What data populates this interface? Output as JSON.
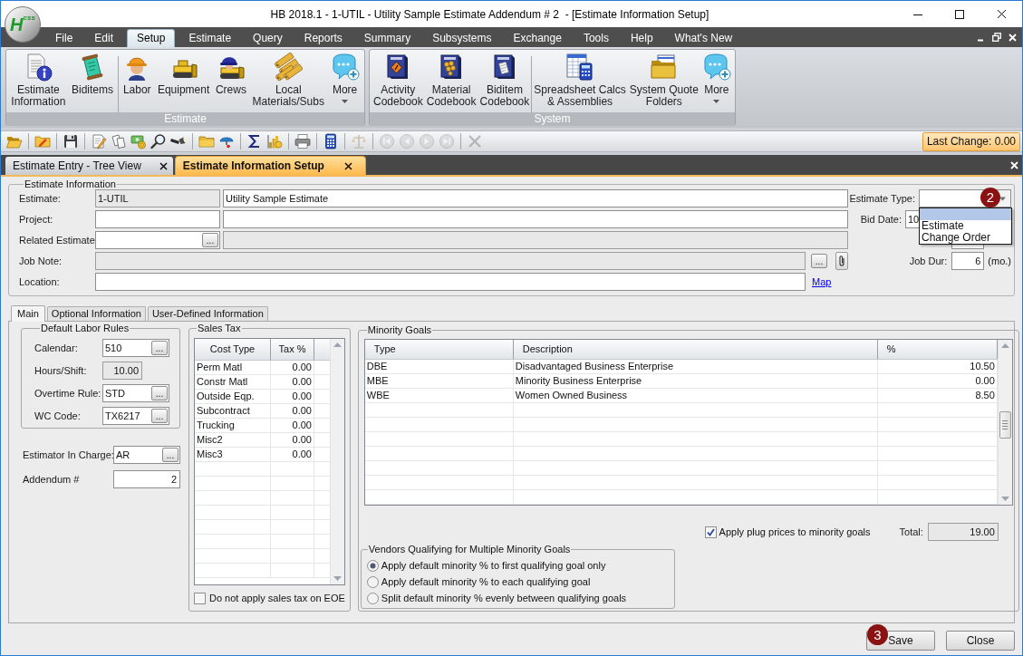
{
  "window": {
    "logo": "H$^{css}$",
    "title": "HB 2018.1 - 1-UTIL - Utility Sample Estimate Addendum # 2  - [Estimate Information Setup]"
  },
  "menu": [
    {
      "label": "File",
      "selected": false
    },
    {
      "label": "Edit",
      "selected": false
    },
    {
      "label": "Setup",
      "selected": true
    },
    {
      "label": "Estimate",
      "selected": false
    },
    {
      "label": "Query",
      "selected": false
    },
    {
      "label": "Reports",
      "selected": false
    },
    {
      "label": "Summary",
      "selected": false
    },
    {
      "label": "Subsystems",
      "selected": false
    },
    {
      "label": "Exchange",
      "selected": false
    },
    {
      "label": "Tools",
      "selected": false
    },
    {
      "label": "Help",
      "selected": false
    },
    {
      "label": "What's New",
      "selected": false
    }
  ],
  "ribbon": {
    "groups": [
      {
        "label": "Estimate",
        "sections": [
          [
            {
              "kind": "document-info",
              "lines": [
                "Estimate",
                "Information"
              ],
              "dropdown": false
            },
            {
              "kind": "scroll",
              "lines": [
                "Biditems"
              ],
              "dropdown": false
            }
          ],
          [
            {
              "kind": "worker",
              "lines": [
                "Labor"
              ],
              "dropdown": false
            },
            {
              "kind": "bulldozer",
              "lines": [
                "Equipment"
              ],
              "dropdown": false
            },
            {
              "kind": "crew",
              "lines": [
                "Crews"
              ],
              "dropdown": false
            },
            {
              "kind": "pipes",
              "lines": [
                "Local",
                "Materials/Subs"
              ],
              "dropdown": false
            },
            {
              "kind": "more",
              "lines": [
                "More"
              ],
              "dropdown": true
            }
          ]
        ]
      },
      {
        "label": "System",
        "sections": [
          [
            {
              "kind": "book-sign",
              "lines": [
                "Activity",
                "Codebook"
              ],
              "dropdown": false
            },
            {
              "kind": "book-pipes",
              "lines": [
                "Material",
                "Codebook"
              ],
              "dropdown": false
            },
            {
              "kind": "book-scroll",
              "lines": [
                "Biditem",
                "Codebook"
              ],
              "dropdown": false
            }
          ],
          [
            {
              "kind": "spreadsheet",
              "lines": [
                "Spreadsheet Calcs",
                "& Assemblies"
              ],
              "dropdown": false
            },
            {
              "kind": "folders",
              "lines": [
                "System Quote",
                "Folders"
              ],
              "dropdown": false
            },
            {
              "kind": "more",
              "lines": [
                "More"
              ],
              "dropdown": true
            }
          ]
        ]
      }
    ]
  },
  "toolbar": {
    "sections": [
      [
        {
          "kind": "open",
          "disabled": false
        }
      ],
      [
        {
          "kind": "folder-pencil",
          "disabled": false
        }
      ],
      [
        {
          "kind": "save",
          "disabled": false
        }
      ],
      [
        {
          "kind": "notes",
          "disabled": false
        },
        {
          "kind": "copy",
          "disabled": false
        },
        {
          "kind": "money",
          "disabled": false
        },
        {
          "kind": "search",
          "disabled": false
        },
        {
          "kind": "flashlight",
          "disabled": false
        }
      ],
      [
        {
          "kind": "folder",
          "disabled": false
        },
        {
          "kind": "dish",
          "disabled": false
        }
      ],
      [
        {
          "kind": "sum",
          "disabled": false
        },
        {
          "kind": "chart",
          "disabled": false
        }
      ],
      [
        {
          "kind": "print",
          "disabled": false
        }
      ],
      [
        {
          "kind": "calculator",
          "disabled": false
        }
      ],
      [
        {
          "kind": "scale",
          "disabled": true
        }
      ],
      [
        {
          "kind": "first",
          "disabled": true
        },
        {
          "kind": "previous",
          "disabled": true
        },
        {
          "kind": "next",
          "disabled": true
        },
        {
          "kind": "last",
          "disabled": true
        }
      ],
      [
        {
          "kind": "delete",
          "disabled": true
        }
      ]
    ],
    "last_change": "Last Change: 0.00"
  },
  "document_tabs": [
    {
      "label": "Estimate Entry - Tree View",
      "selected": false
    },
    {
      "label": "Estimate Information Setup",
      "selected": true
    }
  ],
  "estimate_information": {
    "title": "Estimate Information",
    "rows": [
      {
        "label": "Estimate:",
        "fields": [
          {
            "kind": "short",
            "value": "1-UTIL",
            "disabled": true
          },
          {
            "kind": "wide",
            "value": "Utility Sample Estimate",
            "disabled": false
          }
        ]
      },
      {
        "label": "Project:",
        "fields": [
          {
            "kind": "short",
            "disabled": false
          },
          {
            "kind": "wide",
            "disabled": false
          }
        ]
      },
      {
        "label": "Related Estimate:",
        "fields": [
          {
            "kind": "short",
            "disabled": false,
            "lookup": "..."
          },
          {
            "kind": "wide",
            "disabled": true
          }
        ]
      },
      {
        "label": "Job Note:",
        "fields": [
          {
            "kind": "full",
            "disabled": true,
            "button": "...",
            "attachment": true
          }
        ]
      },
      {
        "label": "Location:",
        "fields": [
          {
            "kind": "full",
            "disabled": false,
            "link": "Map"
          }
        ]
      }
    ],
    "estimate_type": {
      "label": "Estimate Type:",
      "marker": "2",
      "expanded": true,
      "blank_option_selected": true,
      "options": [
        {
          "label": "Estimate",
          "selected": false
        },
        {
          "label": "Change Order",
          "selected": false
        }
      ]
    },
    "bid_date": {
      "label": "Bid Date:",
      "value": "10"
    },
    "job_duration": {
      "label": "Job Dur:",
      "value": "6",
      "unit": "(mo.)"
    }
  },
  "tabs": [
    {
      "label": "Main",
      "selected": true
    },
    {
      "label": "Optional Information",
      "selected": false
    },
    {
      "label": "User-Defined Information",
      "selected": false
    }
  ],
  "default_labor_rules": {
    "title": "Default Labor Rules",
    "fields": [
      {
        "label": "Calendar:",
        "value": "510",
        "lookup": "...",
        "disabled": false
      },
      {
        "label": "Hours/Shift:",
        "value": "10.00",
        "disabled": true
      },
      {
        "label": "Overtime Rule:",
        "value": "STD",
        "lookup": "...",
        "disabled": false
      },
      {
        "label": "WC Code:",
        "value": "TX6217",
        "lookup": "...",
        "disabled": false
      }
    ]
  },
  "estimator_in_charge": {
    "label": "Estimator In Charge:",
    "value": "AR",
    "lookup": "..."
  },
  "addendum": {
    "label": "Addendum #",
    "value": "2"
  },
  "sales_tax": {
    "title": "Sales Tax",
    "columns": [
      "Cost Type",
      "Tax %"
    ],
    "rows": [
      [
        "Perm Matl",
        "0.00"
      ],
      [
        "Constr Matl",
        "0.00"
      ],
      [
        "Outside Eqp.",
        "0.00"
      ],
      [
        "Subcontract",
        "0.00"
      ],
      [
        "Trucking",
        "0.00"
      ],
      [
        "Misc2",
        "0.00"
      ],
      [
        "Misc3",
        "0.00"
      ]
    ],
    "no_tax_on_eoe": {
      "label": "Do not apply sales tax on EOE",
      "checked": false
    }
  },
  "minority_goals": {
    "title": "Minority Goals",
    "columns": [
      "Type",
      "Description",
      "%"
    ],
    "rows": [
      [
        "DBE",
        "Disadvantaged Business Enterprise",
        "10.50"
      ],
      [
        "MBE",
        "Minority Business Enterprise",
        "0.00"
      ],
      [
        "WBE",
        "Women Owned Business",
        "8.50"
      ]
    ],
    "plug_prices": {
      "label": "Apply plug prices to minority goals",
      "checked": true
    },
    "total": {
      "label": "Total:",
      "value": "19.00"
    },
    "vendors": {
      "title": "Vendors Qualifying for Multiple Minority Goals",
      "options": [
        {
          "label": "Apply default minority % to first qualifying goal only",
          "selected": true
        },
        {
          "label": "Apply default minority % to each qualifying goal",
          "selected": false
        },
        {
          "label": "Split default minority % evenly between qualifying goals",
          "selected": false
        }
      ]
    }
  },
  "buttons": [
    {
      "label": "Save",
      "marker": "3"
    },
    {
      "label": "Close"
    }
  ]
}
